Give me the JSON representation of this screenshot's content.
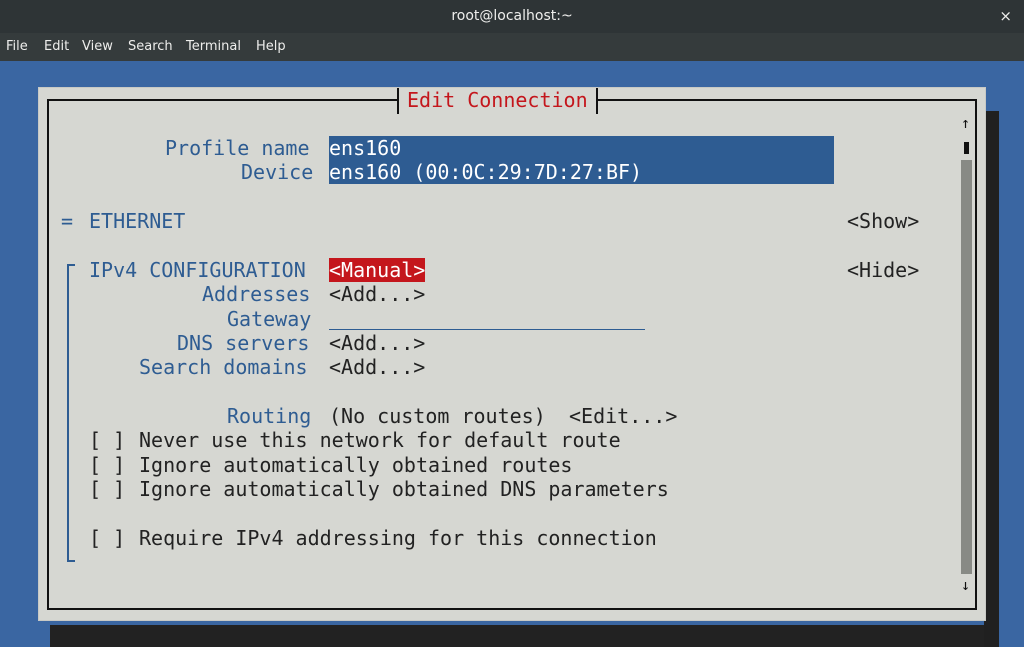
{
  "window": {
    "title": "root@localhost:~",
    "close": "×"
  },
  "menu": [
    "File",
    "Edit",
    "View",
    "Search",
    "Terminal",
    "Help"
  ],
  "dialog": {
    "title": "Edit Connection",
    "profile_name_label": "Profile name",
    "profile_name_value": "ens160",
    "device_label": "Device",
    "device_value": "ens160 (00:0C:29:7D:27:BF)",
    "ethernet": {
      "marker": "=",
      "label": "ETHERNET",
      "toggle": "<Show>"
    },
    "ipv4": {
      "marker": "╤",
      "label": "IPv4 CONFIGURATION",
      "mode": "<Manual>",
      "toggle": "<Hide>",
      "addresses_label": "Addresses",
      "addresses_value": "<Add...>",
      "gateway_label": "Gateway",
      "gateway_value": "",
      "dns_label": "DNS servers",
      "dns_value": "<Add...>",
      "search_label": "Search domains",
      "search_value": "<Add...>",
      "routing_label": "Routing",
      "routing_value": "(No custom routes)",
      "routing_edit": "<Edit...>",
      "checkbox_box": "[ ]",
      "checkboxes": [
        "Never use this network for default route",
        "Ignore automatically obtained routes",
        "Ignore automatically obtained DNS parameters",
        "Require IPv4 addressing for this connection"
      ]
    },
    "scroll_up": "↑",
    "scroll_down": "↓"
  }
}
